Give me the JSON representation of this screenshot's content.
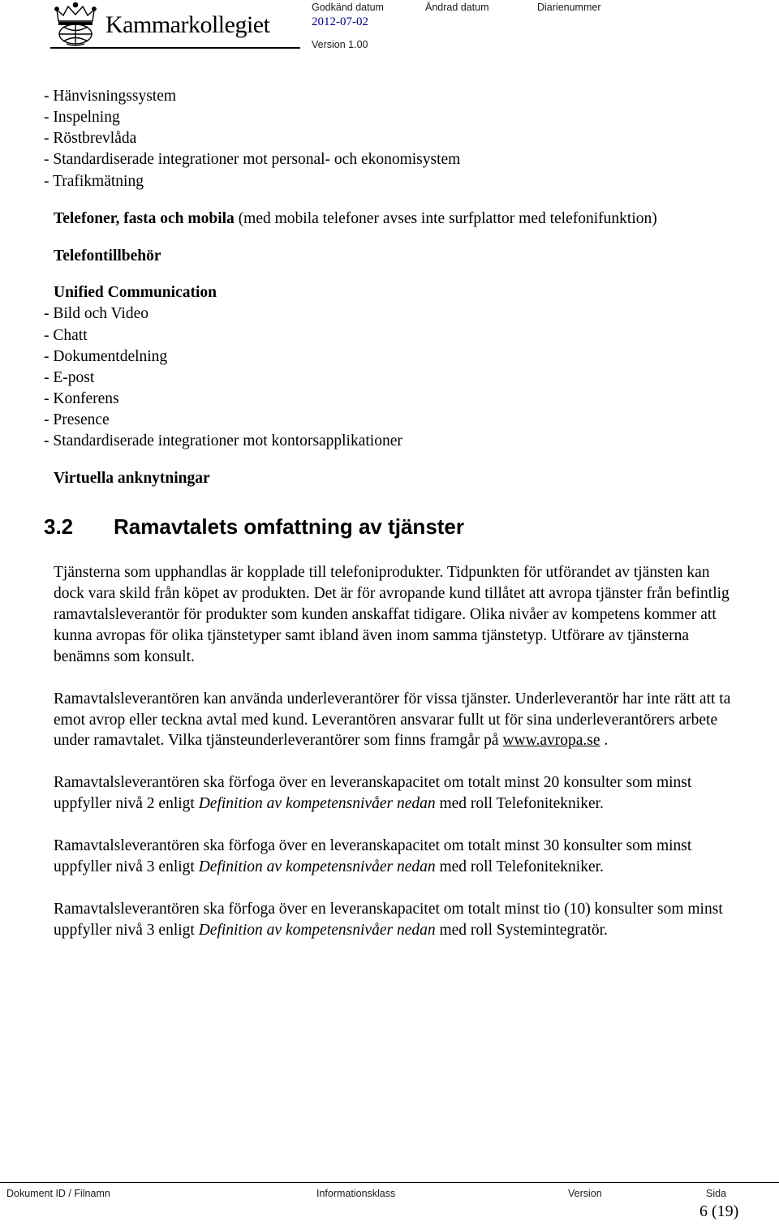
{
  "header": {
    "labels": {
      "godkand": "Godkänd datum",
      "andrad": "Ändrad datum",
      "diarienummer": "Diarienummer"
    },
    "values": {
      "godkand": "2012-07-02",
      "andrad": "",
      "diarienummer": ""
    },
    "version": "Version 1.00",
    "logo_text": "Kammarkollegiet"
  },
  "content": {
    "list1": [
      "- Hänvisningssystem",
      "- Inspelning",
      "- Röstbrevlåda",
      "- Standardiserade integrationer mot personal- och ekonomisystem",
      "- Trafikmätning"
    ],
    "telefoner_heading": "Telefoner, fasta och mobila",
    "telefoner_rest": " (med mobila telefoner avses inte surfplattor med telefonifunktion)",
    "telefontillbehor": "Telefontillbehör",
    "unified_communication": "Unified Communication",
    "list2": [
      "- Bild och Video",
      "- Chatt",
      "- Dokumentdelning",
      "- E-post",
      "- Konferens",
      "- Presence",
      "- Standardiserade integrationer mot kontorsapplikationer"
    ],
    "virtuella": "Virtuella anknytningar",
    "section": {
      "number": "3.2",
      "title": "Ramavtalets omfattning av tjänster"
    },
    "paragraphs": {
      "p1": "Tjänsterna som upphandlas är kopplade till telefoniprodukter. Tidpunkten för utförandet av tjänsten kan dock vara skild från köpet av produkten. Det är för avropande kund tillåtet att avropa tjänster från befintlig ramavtalsleverantör för produkter som kunden anskaffat tidigare. Olika nivåer av kompetens kommer att kunna avropas för olika tjänstetyper samt ibland även inom samma tjänstetyp. Utförare av tjänsterna benämns som konsult.",
      "p2_a": "Ramavtalsleverantören kan använda underleverantörer för vissa tjänster. Underleverantör har inte rätt att ta emot avrop eller teckna avtal med kund. Leverantören ansvarar fullt ut för sina underleverantörers arbete under ramavtalet. Vilka tjänsteunderleverantörer som finns framgår på ",
      "p2_link": "www.avropa.se",
      "p2_b": " .",
      "p3_a": "Ramavtalsleverantören ska förfoga över en leveranskapacitet om totalt minst 20 konsulter som minst uppfyller nivå 2 enligt ",
      "p3_italic": "Definition av kompetensnivåer nedan",
      "p3_b": " med roll ",
      "p3_c": "Telefonitekniker.",
      "p4_a": "Ramavtalsleverantören ska förfoga över en leveranskapacitet om totalt minst 30 konsulter som minst uppfyller nivå 3 enligt ",
      "p4_italic": "Definition av kompetensnivåer nedan",
      "p4_b": " med roll Telefonitekniker.",
      "p5_a": "Ramavtalsleverantören ska förfoga över en leveranskapacitet om totalt minst tio (10) konsulter som minst uppfyller nivå 3 enligt ",
      "p5_italic": "Definition av kompetensnivåer nedan",
      "p5_b": " med roll Systemintegratör."
    }
  },
  "footer": {
    "doc_label": "Dokument ID / Filnamn",
    "info_label": "Informationsklass",
    "version_label": "Version",
    "sida_label": "Sida",
    "page_number": "6 (19)"
  }
}
